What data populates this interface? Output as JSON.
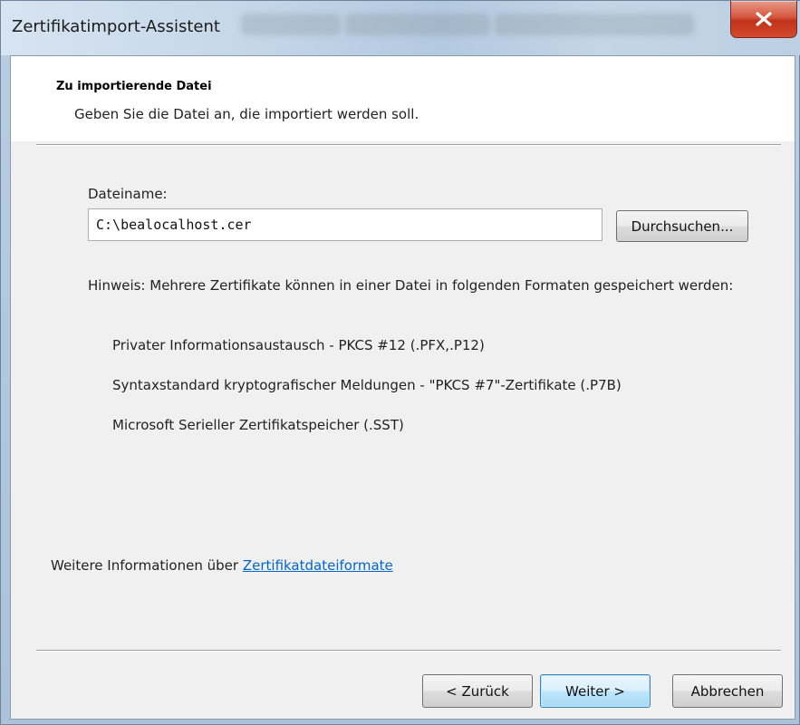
{
  "window": {
    "title": "Zertifikatimport-Assistent",
    "close_icon": "close-x-icon"
  },
  "header": {
    "title": "Zu importierende Datei",
    "subtitle": "Geben Sie die Datei an, die importiert werden soll."
  },
  "file": {
    "label": "Dateiname:",
    "value": "C:\\bealocalhost.cer",
    "browse_label": "Durchsuchen..."
  },
  "note": "Hinweis: Mehrere Zertifikate können in einer Datei in folgenden Formaten gespeichert werden:",
  "formats": [
    "Privater Informationsaustausch - PKCS #12 (.PFX,.P12)",
    "Syntaxstandard kryptografischer Meldungen - \"PKCS #7\"-Zertifikate (.P7B)",
    "Microsoft Serieller Zertifikatspeicher (.SST)"
  ],
  "more_info": {
    "prefix": "Weitere Informationen über",
    "link": "Zertifikatdateiformate"
  },
  "buttons": {
    "back": "< Zurück",
    "next": "Weiter >",
    "cancel": "Abbrechen"
  },
  "colors": {
    "link": "#0066cc",
    "close_button": "#c0321b",
    "default_button_border": "#3c7fb1"
  }
}
